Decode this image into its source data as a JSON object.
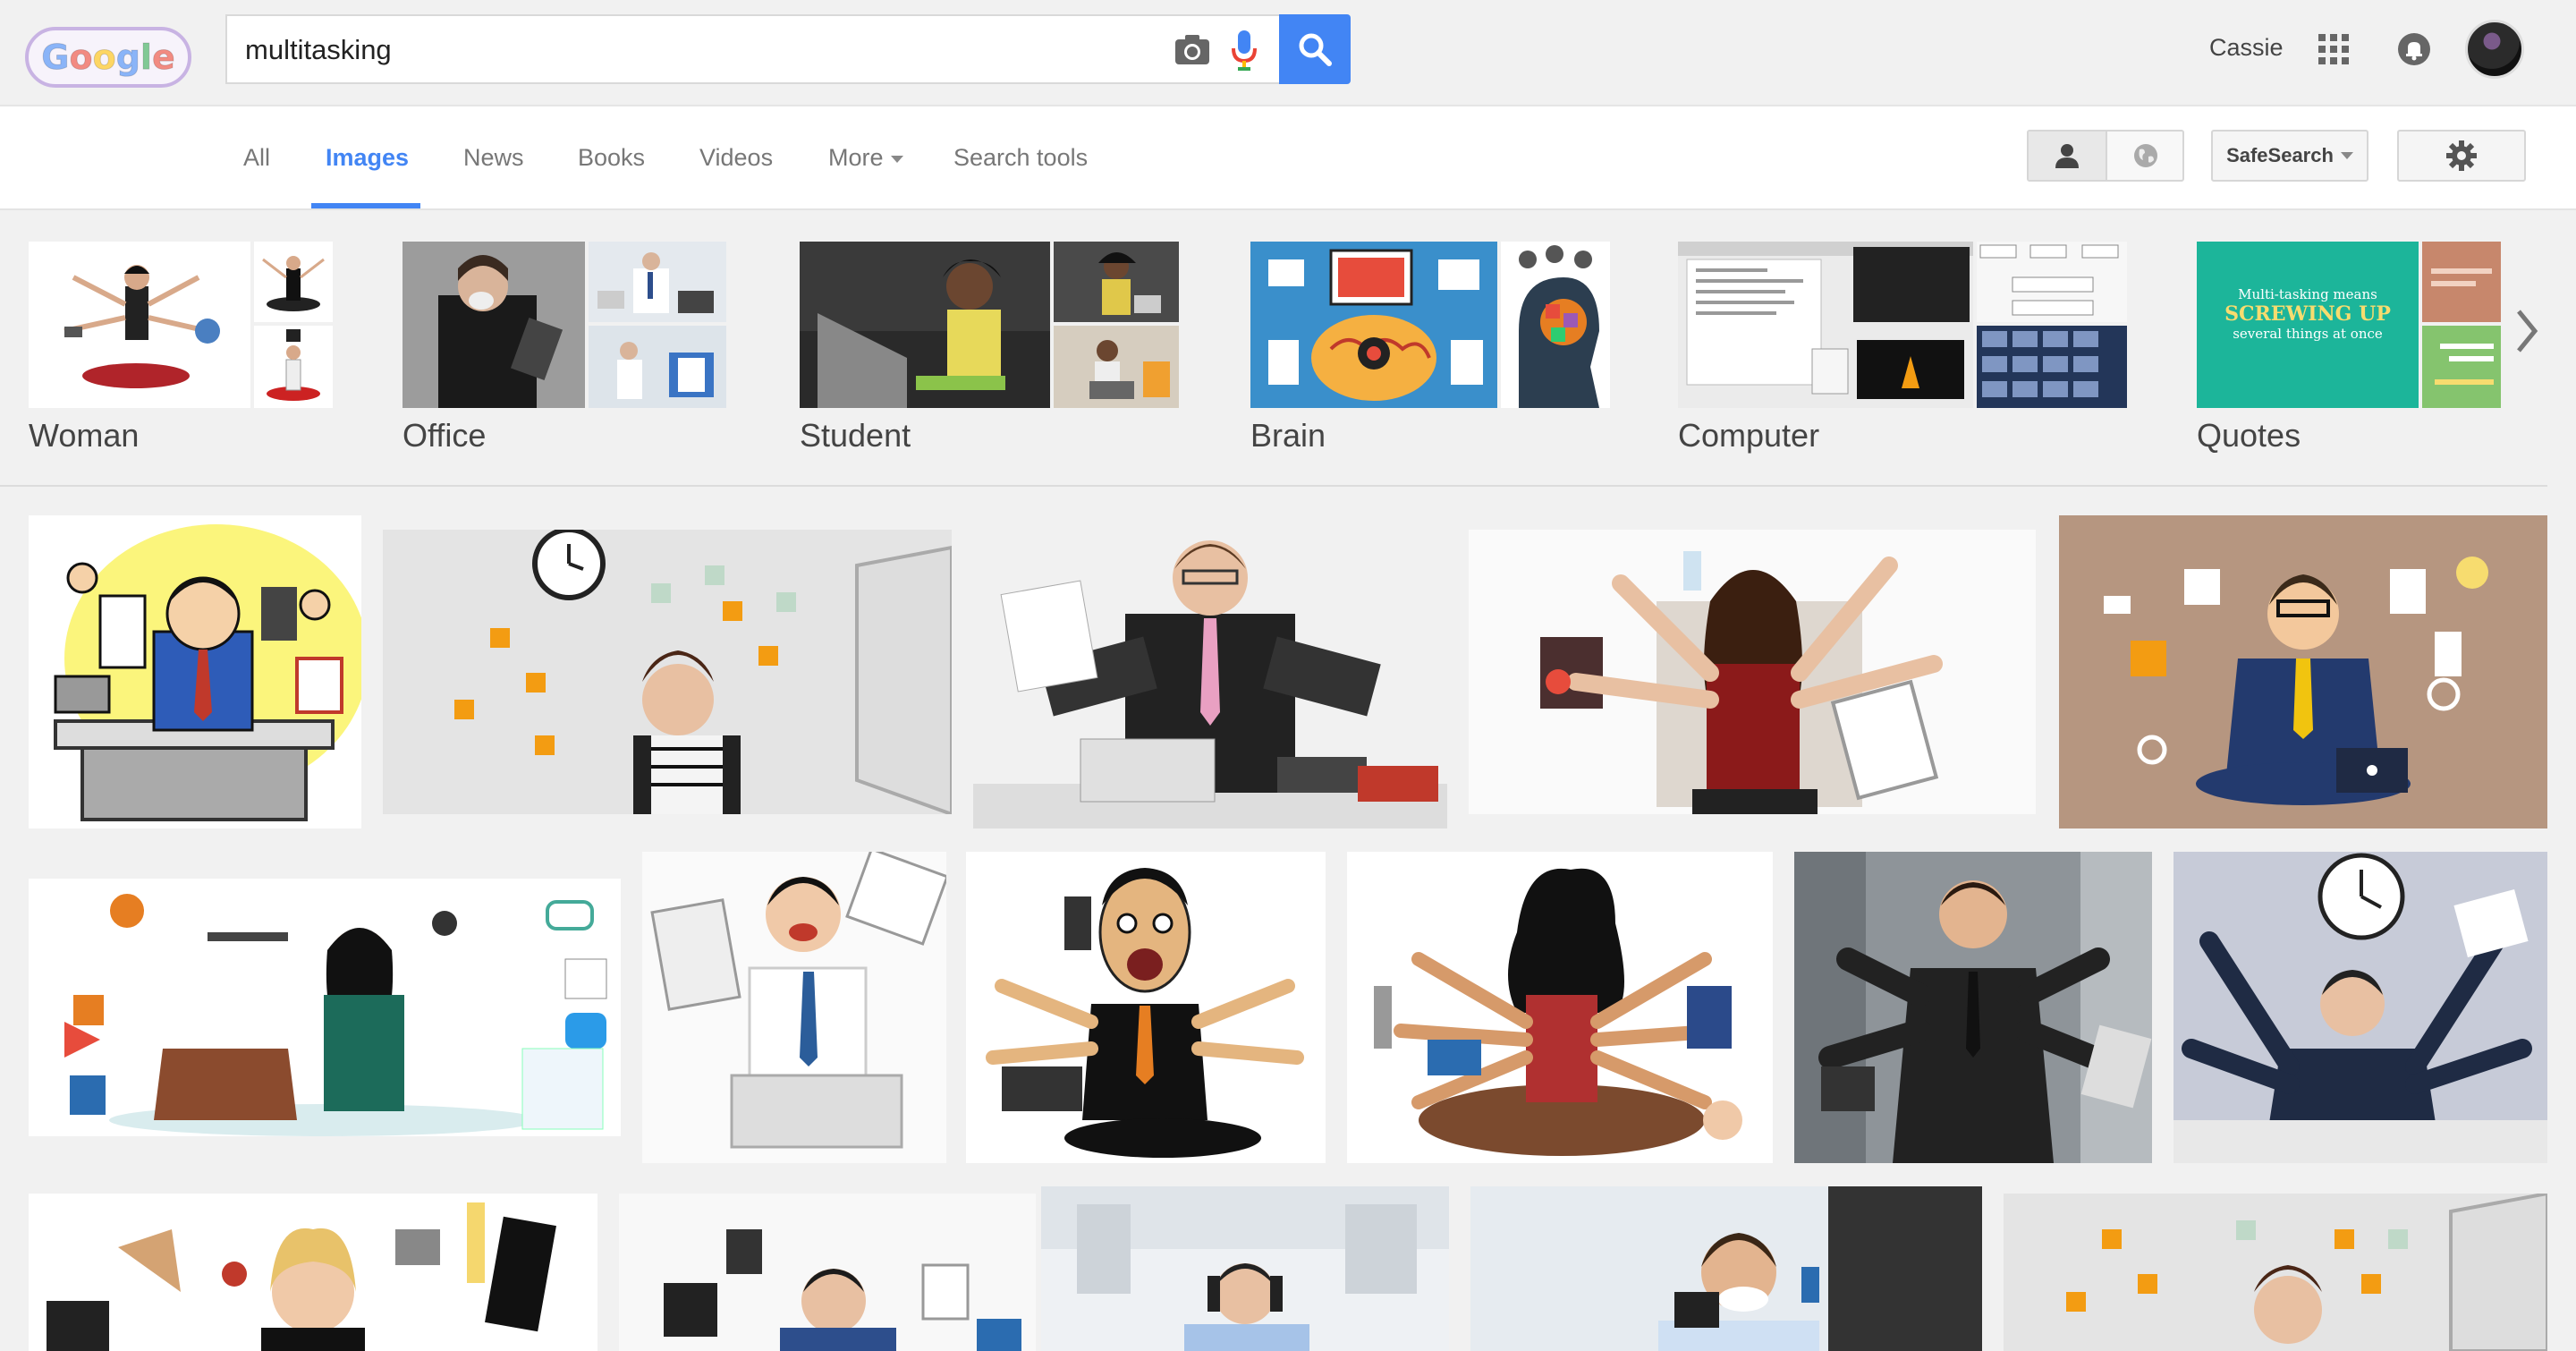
{
  "header": {
    "logo_text": "Google",
    "search_query": "multitasking",
    "user_name": "Cassie"
  },
  "icons": {
    "camera": "camera-icon",
    "mic": "microphone-icon",
    "search": "search-icon",
    "apps": "apps-grid-icon",
    "notifications": "bell-icon",
    "person": "person-icon",
    "globe": "globe-icon",
    "settings": "gear-icon",
    "next": "chevron-right-icon"
  },
  "nav": {
    "tabs": [
      {
        "label": "All"
      },
      {
        "label": "Images"
      },
      {
        "label": "News"
      },
      {
        "label": "Books"
      },
      {
        "label": "Videos"
      },
      {
        "label": "More"
      },
      {
        "label": "Search tools"
      }
    ],
    "safesearch_label": "SafeSearch"
  },
  "related": [
    {
      "label": "Woman"
    },
    {
      "label": "Office"
    },
    {
      "label": "Student"
    },
    {
      "label": "Brain"
    },
    {
      "label": "Computer"
    },
    {
      "label": "Quotes"
    }
  ],
  "quote_thumb_text": [
    "Multi-tasking means",
    "SCREWING UP",
    "several things at once"
  ],
  "colors": {
    "accent": "#4285f4",
    "header_bg": "#f1f1f1",
    "nav_bg": "#ffffff"
  }
}
